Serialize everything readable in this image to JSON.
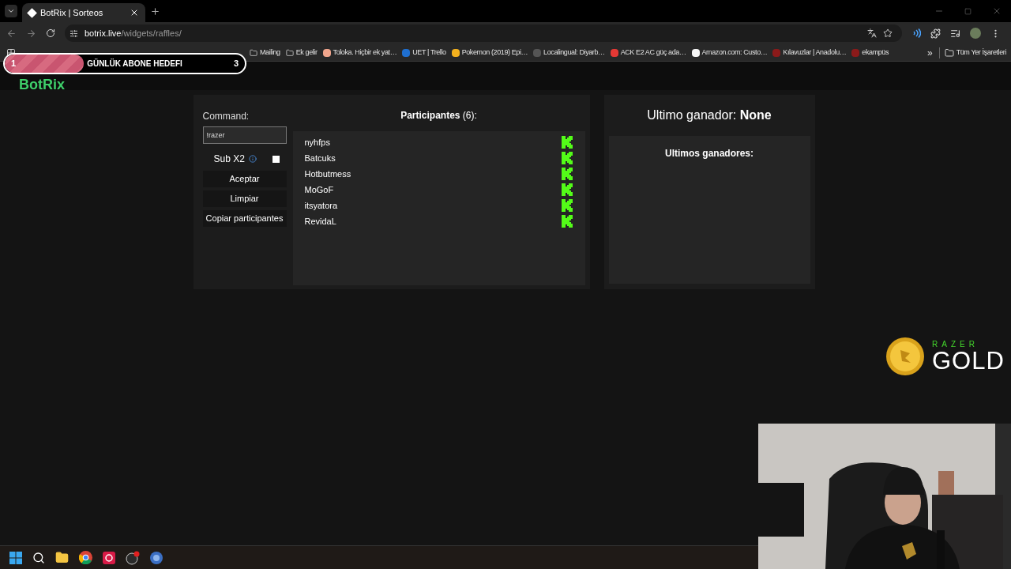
{
  "browser": {
    "tab": {
      "title": "BotRix | Sorteos"
    },
    "url": {
      "host": "botrix.live",
      "path": "/widgets/raffles/"
    },
    "bookmarks": [
      {
        "label": "Mailing",
        "kind": "folder"
      },
      {
        "label": "Ek gelir",
        "kind": "folder"
      },
      {
        "label": "Toloka. Hiçbir ek yat…",
        "kind": "favicon",
        "color": "#f0a58c"
      },
      {
        "label": "UET | Trello",
        "kind": "favicon",
        "color": "#1f6fd0"
      },
      {
        "label": "Pokemon (2019) Epi…",
        "kind": "favicon",
        "color": "#f2b01e"
      },
      {
        "label": "Localingual: Diyarb…",
        "kind": "favicon",
        "color": "#555555"
      },
      {
        "label": "ACK E2 AC güç ada…",
        "kind": "favicon",
        "color": "#e53935"
      },
      {
        "label": "Amazon.com: Custo…",
        "kind": "favicon",
        "color": "#f5f5f5"
      },
      {
        "label": "Kılavuzlar | Anadolu…",
        "kind": "favicon",
        "color": "#8b1a1a"
      },
      {
        "label": "ekampüs",
        "kind": "favicon",
        "color": "#8b1a1a"
      }
    ],
    "more": "»",
    "all_bookmarks": "Tüm Yer İşaretleri"
  },
  "goal_overlay": {
    "current": "1",
    "label": "GÜNLÜK ABONE HEDEFI",
    "target": "3",
    "level": 0.33
  },
  "logo": "BotRix",
  "raffle": {
    "command_label": "Command:",
    "command_value": "!razer",
    "sub_x2": {
      "label": "Sub X2",
      "checked": false
    },
    "buttons": [
      "Aceptar",
      "Limpiar",
      "Copiar participantes"
    ],
    "participants_title": "Participantes",
    "participants_count": "(6):",
    "participants": [
      {
        "name": "nyhfps"
      },
      {
        "name": "Batcuks"
      },
      {
        "name": "Hotbutmess"
      },
      {
        "name": "MoGoF"
      },
      {
        "name": "itsyatora"
      },
      {
        "name": "RevidaL"
      }
    ],
    "last_winner_label": "Ultimo ganador:",
    "last_winner": "None",
    "winners_title": "Ultimos ganadores:"
  },
  "sponsor": {
    "brand": "RAZER",
    "product": "GOLD"
  }
}
